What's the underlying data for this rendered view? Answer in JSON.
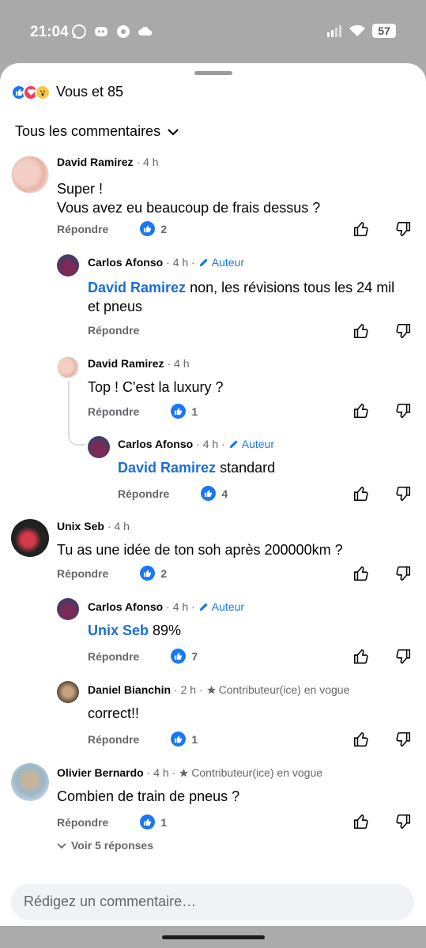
{
  "status": {
    "time": "21:04",
    "battery": "57"
  },
  "reactions": {
    "summary": "Vous et 85"
  },
  "filter": {
    "label": "Tous les commentaires"
  },
  "reply_label": "Répondre",
  "author_badge": "Auteur",
  "contrib_badge": "Contributeur(ice) en vogue",
  "comments": [
    {
      "name": "David Ramirez",
      "time": "· 4 h",
      "line1": "Super !",
      "line2": "Vous avez eu beaucoup de frais dessus ?",
      "likes": "2"
    },
    {
      "name": "Carlos Afonso",
      "time": "· 4 h ·",
      "mention": "David Ramirez",
      "text": " non, les révisions tous les 24 mil",
      "line2": "et pneus"
    },
    {
      "name": "David Ramirez",
      "time": "· 4 h",
      "text": "Top ! C'est la luxury ?",
      "likes": "1"
    },
    {
      "name": "Carlos Afonso",
      "time": "· 4 h ·",
      "mention": "David Ramirez",
      "text": " standard",
      "likes": "4"
    },
    {
      "name": "Unix Seb",
      "time": "· 4 h",
      "text": "Tu as une idée de ton soh après 200000km ?",
      "likes": "2"
    },
    {
      "name": "Carlos Afonso",
      "time": "· 4 h ·",
      "mention": "Unix Seb",
      "text": "  89%",
      "likes": "7"
    },
    {
      "name": "Daniel Bianchin",
      "time": "· 2 h ·",
      "text": "correct!!",
      "likes": "1"
    },
    {
      "name": "Olivier Bernardo",
      "time": "· 4 h ·",
      "text": "Combien de train de pneus ?",
      "likes": "1"
    }
  ],
  "more_replies": "Voir 5 réponses",
  "composer": {
    "placeholder": "Rédigez un commentaire…"
  },
  "colors": {
    "accent": "#1877f2",
    "mention": "#1a6ed8",
    "sheet": "#ffffff",
    "backdrop": "#ababab"
  }
}
